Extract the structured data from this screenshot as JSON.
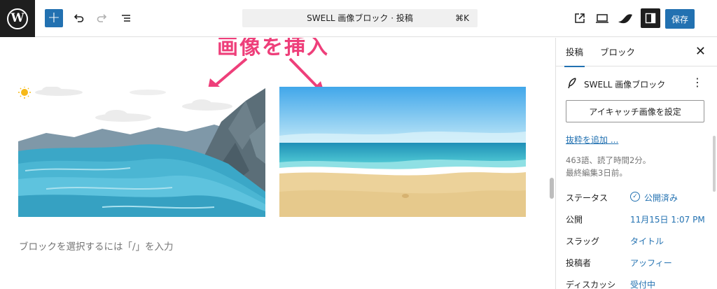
{
  "toolbar": {
    "add_label": "+",
    "command_bar": "SWELL 画像ブロック · 投稿",
    "shortcut": "⌘K",
    "save_label": "保存",
    "accent_color": "#2271b1"
  },
  "canvas": {
    "annotation": "画像を挿入",
    "annotation_color": "#ee3f7a",
    "placeholder": "ブロックを選択するには「/」を入力",
    "images": [
      "mountain-lake-illustration",
      "beach-illustration"
    ]
  },
  "sidebar": {
    "tabs": [
      "投稿",
      "ブロック"
    ],
    "active_tab": "投稿",
    "post_title": "SWELL 画像ブロック",
    "eyecatch_button": "アイキャッチ画像を設定",
    "excerpt_link": "抜粋を追加 ...",
    "stats": "463語、読了時間2分。",
    "last_edited": "最終編集3日前。",
    "rows": [
      {
        "label": "ステータス",
        "value": "公開済み"
      },
      {
        "label": "公開",
        "value": "11月15日 1:07 PM"
      },
      {
        "label": "スラッグ",
        "value": "タイトル"
      },
      {
        "label": "投稿者",
        "value": "アッフィー"
      },
      {
        "label": "ディスカッシ",
        "value": "受付中"
      }
    ]
  }
}
